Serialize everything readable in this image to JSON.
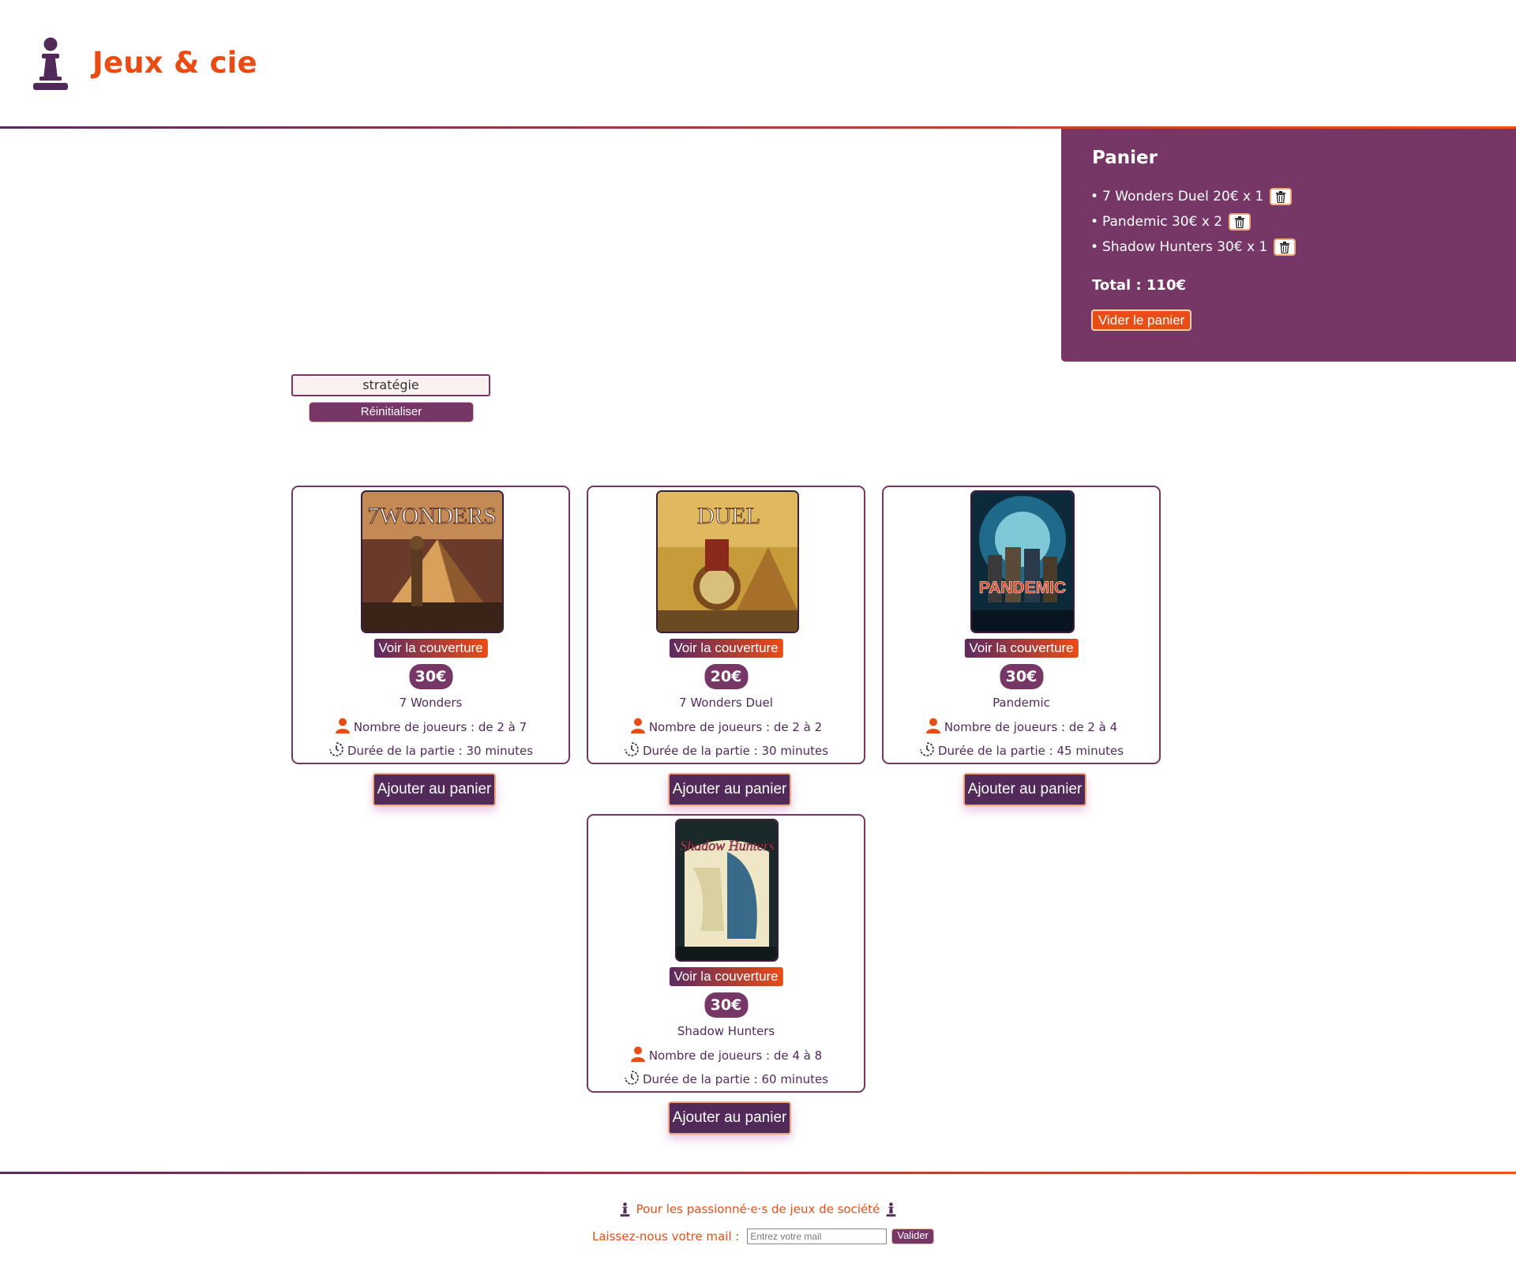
{
  "header": {
    "title": "Jeux & cie",
    "logo_icon": "pawn-icon"
  },
  "cart": {
    "title": "Panier",
    "items": [
      {
        "label": "7 Wonders Duel 20€ x 1"
      },
      {
        "label": "Pandemic 30€ x 2"
      },
      {
        "label": "Shadow Hunters 30€ x 1"
      }
    ],
    "total": "Total : 110€",
    "empty_label": "Vider le panier"
  },
  "filter": {
    "value": "stratégie",
    "reset_label": "Réinitialiser"
  },
  "games": [
    {
      "name": "7 Wonders",
      "price": "30€",
      "cover_label": "Voir la couverture",
      "players": "Nombre de joueurs : de 2 à 7",
      "duration": "Durée de la partie : 30 minutes",
      "add_label": "Ajouter au panier",
      "cover_text": "7WONDERS"
    },
    {
      "name": "7 Wonders Duel",
      "price": "20€",
      "cover_label": "Voir la couverture",
      "players": "Nombre de joueurs : de 2 à 2",
      "duration": "Durée de la partie : 30 minutes",
      "add_label": "Ajouter au panier",
      "cover_text": "DUEL"
    },
    {
      "name": "Pandemic",
      "price": "30€",
      "cover_label": "Voir la couverture",
      "players": "Nombre de joueurs : de 2 à 4",
      "duration": "Durée de la partie : 45 minutes",
      "add_label": "Ajouter au panier",
      "cover_text": "PANDEMIC"
    },
    {
      "name": "Shadow Hunters",
      "price": "30€",
      "cover_label": "Voir la couverture",
      "players": "Nombre de joueurs : de 4 à 8",
      "duration": "Durée de la partie : 60 minutes",
      "add_label": "Ajouter au panier",
      "cover_text": "Shadow Hunters"
    }
  ],
  "footer": {
    "tagline": "Pour les passionné·e·s de jeux de société",
    "newsletter_label": "Laissez-nous votre mail :",
    "email_placeholder": "Entrez votre mail",
    "submit_label": "Valider"
  },
  "colors": {
    "primary": "#773766",
    "dark": "#512a5a",
    "accent": "#e84d16"
  }
}
